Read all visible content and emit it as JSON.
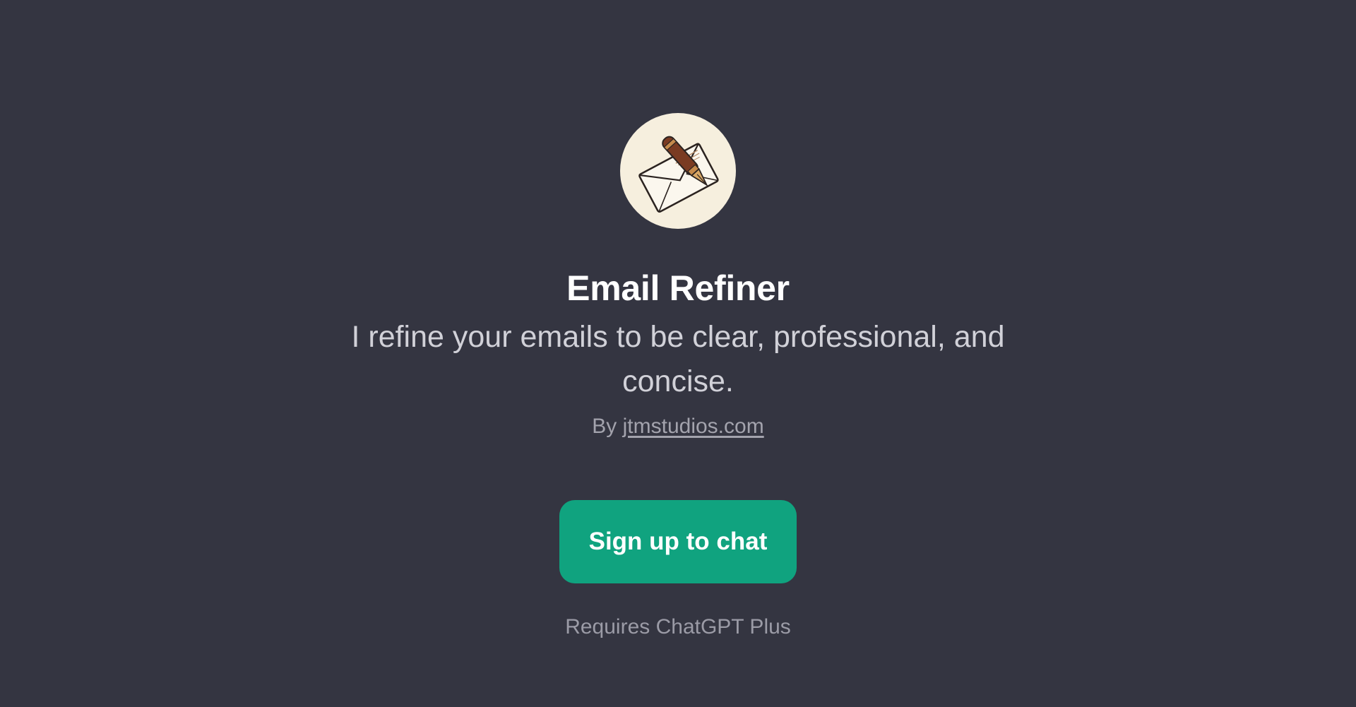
{
  "gpt": {
    "name": "Email Refiner",
    "description": "I refine your emails to be clear, professional, and concise.",
    "by_prefix": "By",
    "author": "jtmstudios.com",
    "avatar_icon": "envelope-fountain-pen-icon"
  },
  "actions": {
    "signup_label": "Sign up to chat"
  },
  "footer": {
    "requirement": "Requires ChatGPT Plus"
  },
  "colors": {
    "background": "#343541",
    "accent": "#10a37f",
    "avatar_bg": "#f6efde"
  }
}
